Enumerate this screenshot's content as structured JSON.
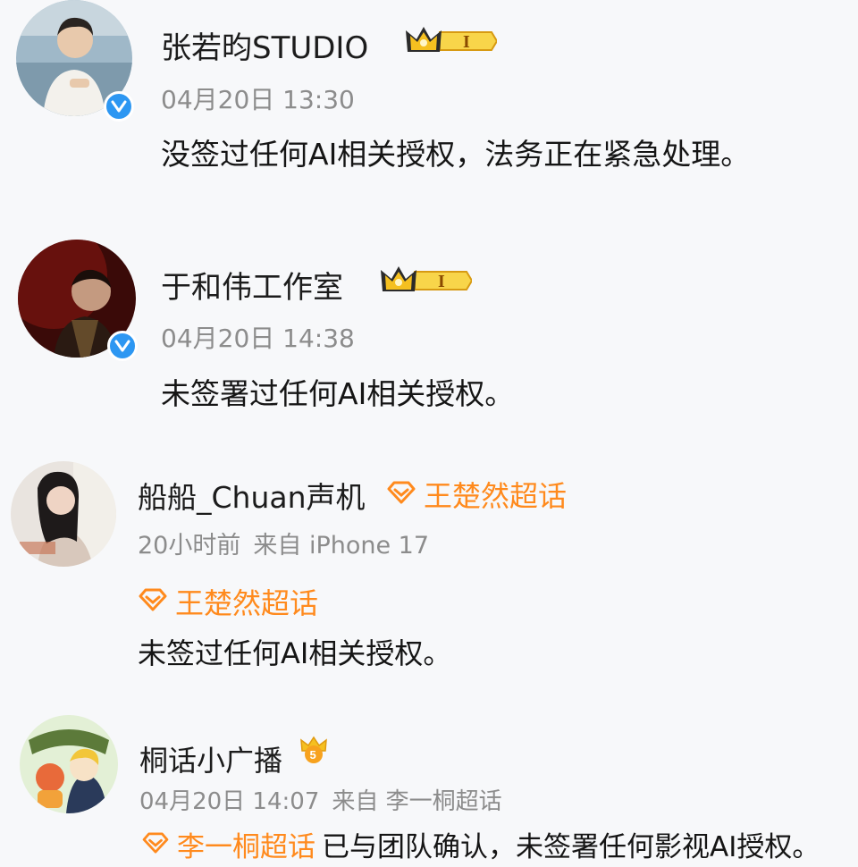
{
  "posts": [
    {
      "name": "张若昀STUDIO",
      "level": "I",
      "time": "04月20日 13:30",
      "text": "没签过任何AI相关授权，法务正在紧急处理。",
      "verified": true,
      "avatar_icon": "person-photo-avatar"
    },
    {
      "name": "于和伟工作室",
      "level": "I",
      "time": "04月20日 14:38",
      "text": "未签署过任何AI相关授权。",
      "verified": true,
      "avatar_icon": "person-photo-avatar"
    },
    {
      "name": "船船_Chuan声机",
      "name_topic": "王楚然超话",
      "time": "20小时前",
      "source": "来自 iPhone 17",
      "topic": "王楚然超话",
      "text": "未签过任何AI相关授权。",
      "avatar_icon": "person-photo-avatar"
    },
    {
      "name": "桐话小广播",
      "fan_badge": "5",
      "time": "04月20日 14:07",
      "source": "来自 李一桐超话",
      "topic": "李一桐超话",
      "text": "已与团队确认，未签署任何影视AI授权。",
      "avatar_icon": "cartoon-avatar"
    }
  ],
  "colors": {
    "background": "#f7f8fa",
    "topic_orange": "#ff8a1d",
    "verified_blue": "#2d97f2",
    "meta_gray": "#8c8c8c",
    "crown_gold": "#f5c020"
  }
}
